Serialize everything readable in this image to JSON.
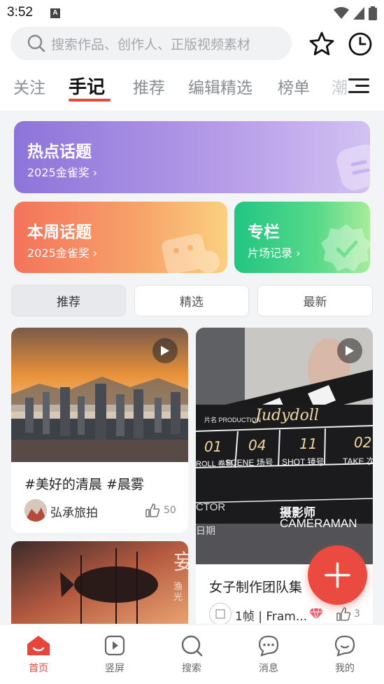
{
  "status_bar": {
    "time": "3:52",
    "notification_glyph": "A"
  },
  "search": {
    "placeholder": "搜索作品、创作人、正版视频素材"
  },
  "tabs": [
    {
      "label": "关注"
    },
    {
      "label": "手记"
    },
    {
      "label": "推荐"
    },
    {
      "label": "编辑精选"
    },
    {
      "label": "榜单"
    },
    {
      "label": "潮"
    }
  ],
  "topic_cards": {
    "hot": {
      "title": "热点话题",
      "subtitle": "2025金雀奖 ›"
    },
    "weekly": {
      "title": "本周话题",
      "subtitle": "2025金雀奖 ›"
    },
    "column": {
      "title": "专栏",
      "subtitle": "片场记录 ›"
    }
  },
  "filters": [
    {
      "label": "推荐"
    },
    {
      "label": "精选"
    },
    {
      "label": "最新"
    }
  ],
  "feed": [
    {
      "title": "#美好的清晨 #晨雾",
      "author": "弘承旅拍",
      "likes": "50"
    },
    {
      "title": "女子制作团队集",
      "author": "1帧 | Fram...",
      "likes": "3"
    }
  ],
  "clapper": {
    "production_label": "片名 PRODUCTION",
    "production_value": "Judydoll",
    "roll": "01",
    "scene": "04",
    "shot": "11",
    "take": "02",
    "labels": [
      "ROLL 卷号",
      "SCENE 场号",
      "SHOT 镜号",
      "TAKE 次"
    ],
    "director": "CTOR",
    "cameraman_cn": "摄影师",
    "cameraman_en": "CAMERAMAN",
    "date": "日期"
  },
  "fish_text": "渔光",
  "bottom_nav": [
    {
      "label": "首页"
    },
    {
      "label": "竖屏"
    },
    {
      "label": "搜索"
    },
    {
      "label": "消息"
    },
    {
      "label": "我的"
    }
  ],
  "colors": {
    "accent": "#e9443c",
    "hot_card": "#8d74d9",
    "week_card": "#f4735b",
    "column_card": "#21c582"
  }
}
